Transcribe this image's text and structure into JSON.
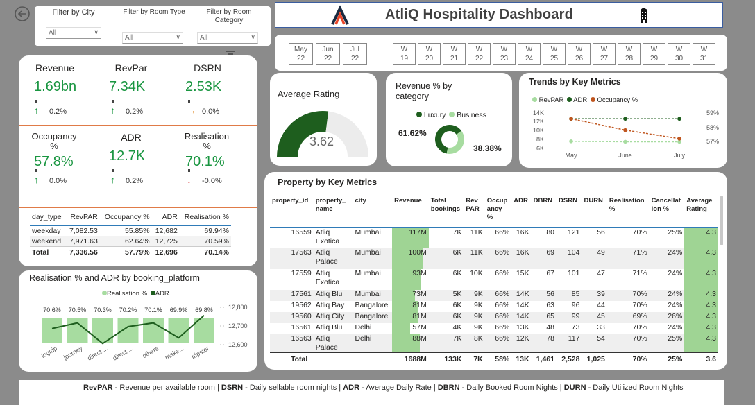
{
  "back": {
    "icon": "back-arrow-icon"
  },
  "filters": [
    {
      "label": "Filter by City",
      "value": "All"
    },
    {
      "label": "Filter by Room Type",
      "value": "All"
    },
    {
      "label": "Filter by Room Category",
      "value": "All"
    }
  ],
  "filter_icon": "filter-icon",
  "header": {
    "title": "AtliQ Hospitality Dashboard",
    "logo": "atliq-logo",
    "icon": "building-icon"
  },
  "months": [
    {
      "m": "May",
      "y": "22"
    },
    {
      "m": "Jun",
      "y": "22"
    },
    {
      "m": "Jul",
      "y": "22"
    }
  ],
  "weeks": [
    "19",
    "20",
    "21",
    "22",
    "23",
    "24",
    "25",
    "26",
    "27",
    "28",
    "29",
    "30",
    "31"
  ],
  "week_prefix": "W",
  "kpis": [
    {
      "name": "Revenue",
      "value": "1.69bn",
      "delta": "0.2%",
      "arrow": "up",
      "color": "#1a9641"
    },
    {
      "name": "RevPar",
      "value": "7.34K",
      "delta": "0.2%",
      "arrow": "up",
      "color": "#1a9641"
    },
    {
      "name": "DSRN",
      "value": "2.53K",
      "delta": "0.0%",
      "arrow": "right",
      "color": "#1a9641"
    },
    {
      "name": "Occupancy %",
      "value": "57.8%",
      "delta": "0.0%",
      "arrow": "up",
      "color": "#1a9641"
    },
    {
      "name": "ADR",
      "value": "12.7K",
      "delta": "0.2%",
      "arrow": "up",
      "color": "#1a9641"
    },
    {
      "name": "Realisation %",
      "value": "70.1%",
      "delta": "-0.0%",
      "arrow": "down",
      "color": "#1a9641"
    }
  ],
  "daytype": {
    "headers": [
      "day_type",
      "RevPAR",
      "Occupancy %",
      "ADR",
      "Realisation %"
    ],
    "rows": [
      [
        "weekday",
        "7,082.53",
        "55.85%",
        "12,682",
        "69.94%"
      ],
      [
        "weekend",
        "7,971.63",
        "62.64%",
        "12,725",
        "70.59%"
      ]
    ],
    "total": [
      "Total",
      "7,336.56",
      "57.79%",
      "12,696",
      "70.14%"
    ]
  },
  "rating": {
    "title": "Average Rating",
    "value": "3.62",
    "fraction": 0.54
  },
  "revcat": {
    "title": "Revenue % by category",
    "legend": [
      "Luxury",
      "Business"
    ],
    "luxury": "61.62%",
    "business": "38.38%",
    "lux_frac": 0.6162
  },
  "trends": {
    "title": "Trends by Key Metrics",
    "legend": [
      "RevPAR",
      "ADR",
      "Occupancy %"
    ],
    "yleft": [
      "14K",
      "12K",
      "10K",
      "8K",
      "6K"
    ],
    "yright": [
      "59%",
      "58%",
      "57%"
    ],
    "x": [
      "May",
      "June",
      "July"
    ]
  },
  "bp": {
    "title": "Realisation % and ADR by booking_platform",
    "legend": [
      "Realisation %",
      "ADR"
    ],
    "cats": [
      "logtrip",
      "journey",
      "direct ...",
      "direct ...",
      "others",
      "make...",
      "tripster"
    ],
    "labels": [
      "70.6%",
      "70.5%",
      "70.3%",
      "70.2%",
      "70.1%",
      "69.9%",
      "69.8%"
    ],
    "right_axis": [
      "12,800",
      "12,700",
      "12,600"
    ]
  },
  "prop": {
    "title": "Property by Key Metrics",
    "headers": [
      "property_id",
      "property_ name",
      "city",
      "Revenue",
      "Total bookings",
      "Rev PAR",
      "Occup ancy %",
      "ADR",
      "DBRN",
      "DSRN",
      "DURN",
      "Realisation %",
      "Cancellat ion %",
      "Average Rating"
    ],
    "rows": [
      [
        "16559",
        "Atliq Exotica",
        "Mumbai",
        "117M",
        "7K",
        "11K",
        "66%",
        "16K",
        "80",
        "121",
        "56",
        "70%",
        "25%",
        "4.3"
      ],
      [
        "17563",
        "Atliq Palace",
        "Mumbai",
        "100M",
        "6K",
        "11K",
        "66%",
        "16K",
        "69",
        "104",
        "49",
        "71%",
        "24%",
        "4.3"
      ],
      [
        "17559",
        "Atliq Exotica",
        "Mumbai",
        "93M",
        "6K",
        "10K",
        "66%",
        "15K",
        "67",
        "101",
        "47",
        "71%",
        "24%",
        "4.3"
      ],
      [
        "17561",
        "Atliq Blu",
        "Mumbai",
        "73M",
        "5K",
        "9K",
        "66%",
        "14K",
        "56",
        "85",
        "39",
        "70%",
        "24%",
        "4.3"
      ],
      [
        "19562",
        "Atliq Bay",
        "Bangalore",
        "81M",
        "6K",
        "9K",
        "66%",
        "14K",
        "63",
        "96",
        "44",
        "70%",
        "24%",
        "4.3"
      ],
      [
        "19560",
        "Atliq City",
        "Bangalore",
        "81M",
        "6K",
        "9K",
        "66%",
        "14K",
        "65",
        "99",
        "45",
        "69%",
        "26%",
        "4.3"
      ],
      [
        "16561",
        "Atliq Blu",
        "Delhi",
        "57M",
        "4K",
        "9K",
        "66%",
        "13K",
        "48",
        "73",
        "33",
        "70%",
        "24%",
        "4.3"
      ],
      [
        "16563",
        "Atliq Palace",
        "Delhi",
        "88M",
        "7K",
        "8K",
        "66%",
        "12K",
        "78",
        "117",
        "54",
        "70%",
        "25%",
        "4.3"
      ]
    ],
    "total": [
      "Total",
      "",
      "",
      "1688M",
      "133K",
      "7K",
      "58%",
      "13K",
      "1,461",
      "2,528",
      "1,025",
      "70%",
      "25%",
      "3.6"
    ]
  },
  "footer": [
    {
      "b": "RevPAR",
      "t": " - Revenue per available room | "
    },
    {
      "b": "DSRN",
      "t": " - Daily sellable room nights | "
    },
    {
      "b": "ADR",
      "t": " - Average Daily Rate | "
    },
    {
      "b": "DBRN",
      "t": " - Daily Booked Room Nights | "
    },
    {
      "b": "DURN",
      "t": " - Daily Utilized Room Nights"
    }
  ],
  "colors": {
    "dark_green": "#1e5e1e",
    "light_green": "#a7dca0",
    "orange": "#c0561f"
  },
  "chart_data": [
    {
      "type": "line",
      "title": "Trends by Key Metrics",
      "x": [
        "May",
        "June",
        "July"
      ],
      "series": [
        {
          "name": "RevPAR",
          "values": [
            7.6,
            7.5,
            7.5
          ]
        },
        {
          "name": "ADR",
          "values": [
            12.7,
            12.7,
            12.7
          ]
        },
        {
          "name": "Occupancy %",
          "values": [
            58.6,
            57.8,
            57.2
          ]
        }
      ]
    },
    {
      "type": "bar",
      "title": "Realisation % and ADR by booking_platform",
      "categories": [
        "logtrip",
        "journey",
        "direct ...",
        "direct ...",
        "others",
        "make...",
        "tripster"
      ],
      "series": [
        {
          "name": "Realisation %",
          "values": [
            70.6,
            70.5,
            70.3,
            70.2,
            70.1,
            69.9,
            69.8
          ]
        },
        {
          "name": "ADR",
          "values": [
            12690,
            12720,
            12610,
            12700,
            12720,
            12640,
            12760
          ]
        }
      ]
    },
    {
      "type": "pie",
      "title": "Revenue % by category",
      "categories": [
        "Luxury",
        "Business"
      ],
      "values": [
        61.62,
        38.38
      ]
    }
  ]
}
